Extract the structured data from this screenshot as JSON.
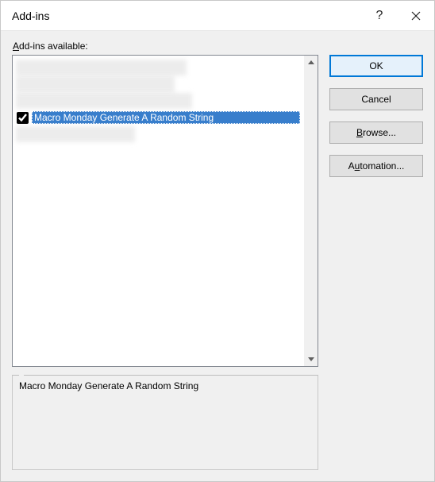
{
  "titlebar": {
    "title": "Add-ins",
    "help": "?",
    "close": "×"
  },
  "content": {
    "label_prefix": "A",
    "label_rest": "dd-ins available:",
    "selected_item": "Macro Monday Generate A Random String",
    "description": "Macro Monday Generate A Random String"
  },
  "buttons": {
    "ok": "OK",
    "cancel": "Cancel",
    "browse_ul": "B",
    "browse_rest": "rowse...",
    "automation_pre": "A",
    "automation_ul": "u",
    "automation_rest": "tomation..."
  }
}
